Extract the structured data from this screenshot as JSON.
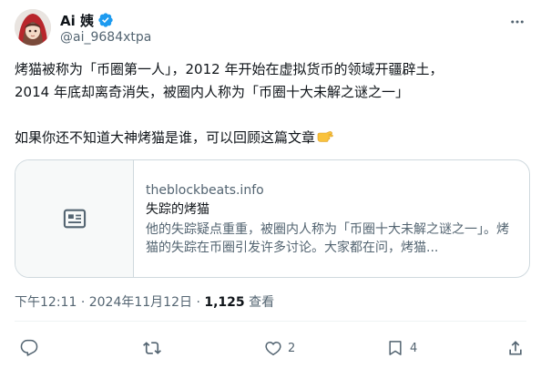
{
  "author": {
    "display_name": "Ai 姨",
    "handle": "@ai_9684xtpa",
    "verified": true,
    "avatar": "cartoon-avatar-red-hood"
  },
  "tweet": {
    "lines": [
      "烤猫被称为「币圈第一人」，2012 年开始在虚拟货币的领域开疆辟土，",
      "2014 年底却离奇消失，被圈内人称为「币圈十大未解之谜之一」",
      "如果你还不知道大神烤猫是谁，可以回顾这篇文章"
    ],
    "emoji": "pointing-right-hand"
  },
  "card": {
    "domain": "theblockbeats.info",
    "title": "失踪的烤猫",
    "description": "他的失踪疑点重重，被圈内人称为「币圈十大未解之谜之一」。烤猫的失踪在币圈引发许多讨论。大家都在问，烤猫...",
    "thumb_icon": "article-icon"
  },
  "meta": {
    "time": "下午12:11",
    "separator": "·",
    "date": "2024年11月12日",
    "views_count": "1,125",
    "views_label": "查看"
  },
  "actions": {
    "reply_count": "",
    "retweet_count": "",
    "like_count": "2",
    "bookmark_count": "4"
  },
  "colors": {
    "text": "#0f1419",
    "secondary": "#536471",
    "border": "#cfd9de",
    "verified": "#1d9bf0"
  }
}
